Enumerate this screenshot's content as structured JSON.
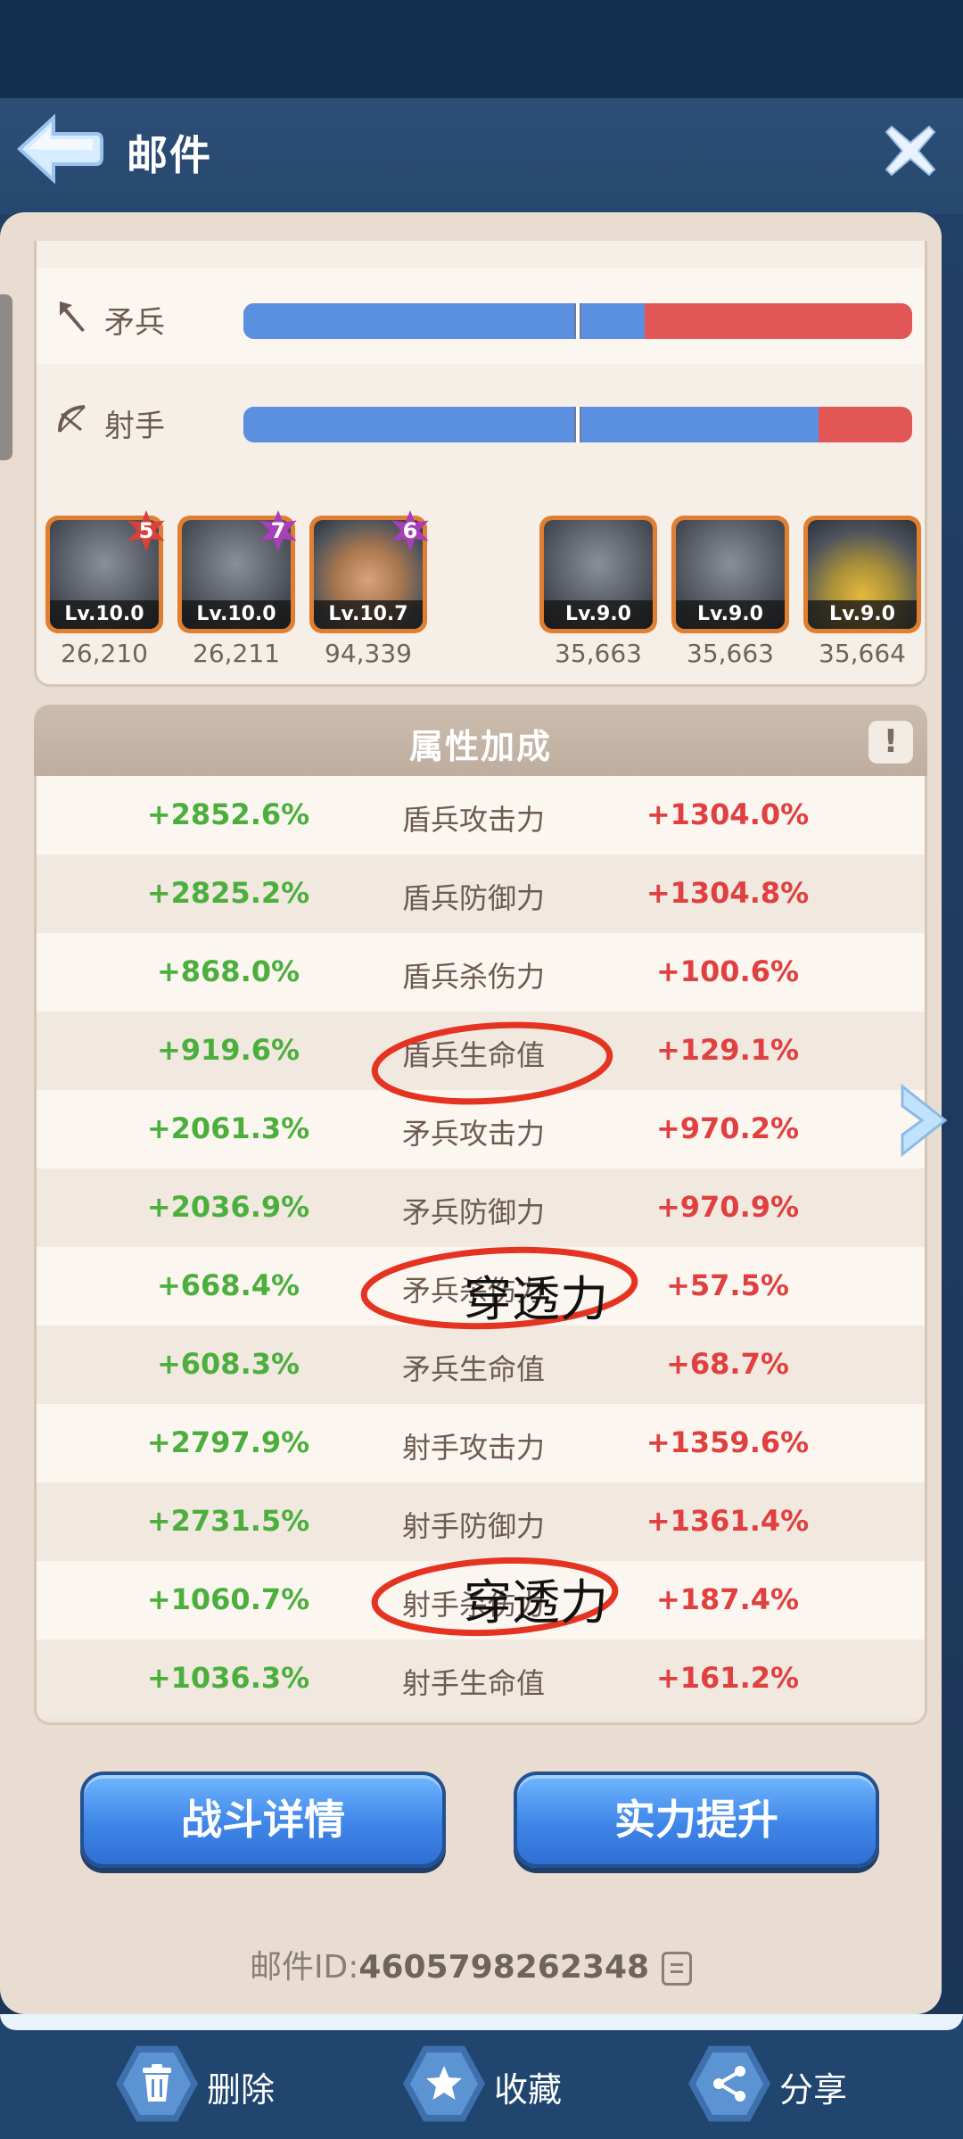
{
  "header": {
    "title": "邮件",
    "back_icon": "back-arrow-icon",
    "close_icon": "close-icon"
  },
  "troop_bars": [
    {
      "label": "矛兵",
      "icon": "spear-icon",
      "blue_fraction": 0.6,
      "marker_fraction": 0.5
    },
    {
      "label": "射手",
      "icon": "bow-icon",
      "blue_fraction": 0.86,
      "marker_fraction": 0.5
    }
  ],
  "heroes": [
    {
      "level": "Lv.10.0",
      "power": "26,210",
      "star": "5",
      "badge_color": "red",
      "face": "helmet"
    },
    {
      "level": "Lv.10.0",
      "power": "26,211",
      "star": "7",
      "badge_color": "purple",
      "face": "helmet"
    },
    {
      "level": "Lv.10.7",
      "power": "94,339",
      "star": "6",
      "badge_color": "purple",
      "face": "human"
    },
    {
      "level": "Lv.9.0",
      "power": "35,663",
      "star": "",
      "badge_color": "",
      "face": "helmet"
    },
    {
      "level": "Lv.9.0",
      "power": "35,663",
      "star": "",
      "badge_color": "",
      "face": "helmet"
    },
    {
      "level": "Lv.9.0",
      "power": "35,664",
      "star": "",
      "badge_color": "",
      "face": "yellow"
    }
  ],
  "attributes": {
    "title": "属性加成",
    "info_label": "!",
    "rows": [
      {
        "left": "+2852.6%",
        "name": "盾兵攻击力",
        "right": "+1304.0%"
      },
      {
        "left": "+2825.2%",
        "name": "盾兵防御力",
        "right": "+1304.8%"
      },
      {
        "left": "+868.0%",
        "name": "盾兵杀伤力",
        "right": "+100.6%"
      },
      {
        "left": "+919.6%",
        "name": "盾兵生命值",
        "right": "+129.1%"
      },
      {
        "left": "+2061.3%",
        "name": "矛兵攻击力",
        "right": "+970.2%"
      },
      {
        "left": "+2036.9%",
        "name": "矛兵防御力",
        "right": "+970.9%"
      },
      {
        "left": "+668.4%",
        "name": "矛兵杀伤力",
        "right": "+57.5%"
      },
      {
        "left": "+608.3%",
        "name": "矛兵生命值",
        "right": "+68.7%"
      },
      {
        "left": "+2797.9%",
        "name": "射手攻击力",
        "right": "+1359.6%"
      },
      {
        "left": "+2731.5%",
        "name": "射手防御力",
        "right": "+1361.4%"
      },
      {
        "left": "+1060.7%",
        "name": "射手杀伤力",
        "right": "+187.4%"
      },
      {
        "left": "+1036.3%",
        "name": "射手生命值",
        "right": "+161.2%"
      }
    ]
  },
  "annotations": {
    "note_1": "穿透力",
    "note_2": "穿透力",
    "circle_color": "#e53322"
  },
  "buttons": {
    "battle_details": "战斗详情",
    "power_up": "实力提升"
  },
  "mail": {
    "id_label": "邮件ID:",
    "id_value": "4605798262348"
  },
  "bottom_bar": {
    "delete": "删除",
    "favorite": "收藏",
    "share": "分享"
  },
  "colors": {
    "ally_value": "#4caf3d",
    "enemy_value": "#e0403f",
    "bar_blue": "#5b8fe0",
    "bar_red": "#e25656",
    "button_blue": "#3f86e8"
  }
}
